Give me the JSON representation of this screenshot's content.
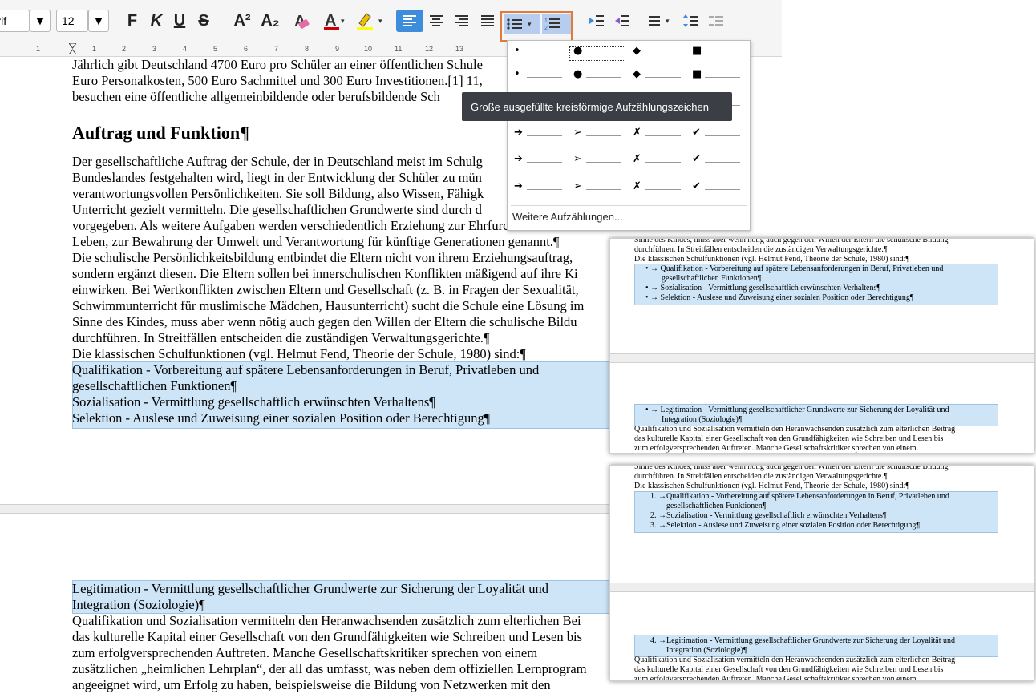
{
  "toolbar": {
    "font_name": "Liberation Serif",
    "font_size": "12",
    "bold": "F",
    "italic": "K",
    "underline": "U",
    "strike": "S",
    "superscript": "A²",
    "subscript": "A₂",
    "accent_color": "#3e8ddd",
    "highlight_border": "#e07b39"
  },
  "ruler": [
    "1",
    "1",
    "2",
    "3",
    "4",
    "5",
    "6",
    "7",
    "8",
    "9",
    "10",
    "11",
    "12",
    "13"
  ],
  "document": {
    "lines_top": [
      "Jährlich gibt Deutschland 4700 Euro pro Schüler an einer öffentlichen Schule",
      "Euro Personalkosten, 500 Euro Sachmittel und 300 Euro Investitionen.[1] 11,",
      "besuchen eine öffentliche allgemeinbildende oder berufsbildende Sch"
    ],
    "heading": "Auftrag und Funktion¶",
    "body_lines": [
      "Der gesellschaftliche Auftrag der Schule, der in Deutschland meist im Schulg",
      "Bundeslandes festgehalten wird, liegt in der Entwicklung der Schüler zu mün",
      "verantwortungsvollen Persönlichkeiten. Sie soll Bildung, also Wissen, Fähigk",
      "Unterricht gezielt vermitteln. Die gesellschaftlichen Grundwerte sind durch d",
      "vorgegeben. Als weitere Aufgaben werden verschiedentlich Erziehung zur Ehrfurcht vor dem",
      "Leben, zur Bewahrung der Umwelt und Verantwortung für künftige Generationen genannt.¶",
      "Die schulische Persönlichkeitsbildung entbindet die Eltern nicht von ihrem Erziehungsauftrag,",
      "sondern ergänzt diesen. Die Eltern sollen bei innerschulischen Konflikten mäßigend auf ihre Ki",
      "einwirken. Bei Wertkonflikten zwischen Eltern und Gesellschaft (z. B. in Fragen der Sexualität,",
      "Schwimmunterricht für muslimische Mädchen, Hausunterricht) sucht die Schule eine Lösung im",
      "Sinne des Kindes, muss aber wenn nötig auch gegen den Willen der Eltern die schulische Bildu",
      "durchführen. In Streitfällen entscheiden die zuständigen Verwaltungsgerichte.¶",
      "Die klassischen Schulfunktionen (vgl. Helmut Fend, Theorie der Schule, 1980) sind:¶"
    ],
    "selected_lines": [
      "Qualifikation - Vorbereitung auf spätere Lebensanforderungen in Beruf, Privatleben und",
      "gesellschaftlichen Funktionen¶",
      "Sozialisation - Vermittlung gesellschaftlich erwünschten Verhaltens¶",
      "Selektion - Auslese und Zuweisung einer sozialen Position oder Berechtigung¶"
    ],
    "page2_selected": [
      "Legitimation - Vermittlung gesellschaftlicher Grundwerte zur Sicherung der Loyalität und",
      "Integration (Soziologie)¶"
    ],
    "page2_lines": [
      "Qualifikation und Sozialisation vermitteln den Heranwachsenden zusätzlich zum elterlichen Bei",
      "das kulturelle Kapital einer Gesellschaft von den Grundfähigkeiten wie Schreiben und Lesen bis",
      "zum erfolgversprechenden Auftreten. Manche Gesellschaftskritiker sprechen von einem",
      "zusätzlichen „heimlichen Lehrplan“, der all das umfasst, was neben dem offiziellen Lernprogram",
      "angeeignet wird, um Erfolg zu haben, beispielsweise die Bildung von Netzwerken mit den"
    ]
  },
  "popup": {
    "more_label": "Weitere Aufzählungen...",
    "rows": [
      [
        "•",
        "●",
        "◆",
        "■"
      ],
      [
        "•",
        "●",
        "◆",
        "■"
      ],
      [
        "•",
        "●",
        "◆",
        "■"
      ],
      [
        "➔",
        "➢",
        "✗",
        "✔"
      ],
      [
        "➔",
        "➢",
        "✗",
        "✔"
      ],
      [
        "➔",
        "➢",
        "✗",
        "✔"
      ]
    ]
  },
  "tooltip": "Große ausgefüllte kreisförmige Aufzählungszeichen",
  "preview1": {
    "top_lines": [
      "Sinne des Kindes, muss aber wenn nötig auch gegen den Willen der Eltern die schulische Bildung",
      "durchführen. In Streitfällen entscheiden die zuständigen Verwaltungsgerichte.¶",
      "Die klassischen Schulfunktionen (vgl. Helmut Fend, Theorie der Schule, 1980) sind:¶"
    ],
    "items": [
      "• → Qualifikation - Vorbereitung auf spätere Lebensanforderungen in Beruf, Privatleben und",
      "gesellschaftlichen Funktionen¶",
      "• → Sozialisation - Vermittlung gesellschaftlich erwünschten Verhaltens¶",
      "• → Selektion - Auslese und Zuweisung einer sozialen Position oder Berechtigung¶"
    ],
    "page2_items": [
      "• → Legitimation - Vermittlung gesellschaftlicher Grundwerte zur Sicherung der Loyalität und",
      "Integration (Soziologie)¶"
    ],
    "page2_lines": [
      "Qualifikation und Sozialisation vermitteln den Heranwachsenden zusätzlich zum elterlichen Beitrag",
      "das kulturelle Kapital einer Gesellschaft von den Grundfähigkeiten wie Schreiben und Lesen bis",
      "zum erfolgversprechenden Auftreten. Manche Gesellschaftskritiker sprechen von einem"
    ]
  },
  "preview2": {
    "top_lines": [
      "Sinne des Kindes, muss aber wenn nötig auch gegen den Willen der Eltern die schulische Bildung",
      "durchführen. In Streitfällen entscheiden die zuständigen Verwaltungsgerichte.¶",
      "Die klassischen Schulfunktionen (vgl. Helmut Fend, Theorie der Schule, 1980) sind:¶"
    ],
    "items": [
      "1. →Qualifikation - Vorbereitung auf spätere Lebensanforderungen in Beruf, Privatleben und",
      "gesellschaftlichen Funktionen¶",
      "2. →Sozialisation - Vermittlung gesellschaftlich erwünschten Verhaltens¶",
      "3. →Selektion - Auslese und Zuweisung einer sozialen Position oder Berechtigung¶"
    ],
    "page2_items": [
      "4. →Legitimation - Vermittlung gesellschaftlicher Grundwerte zur Sicherung der Loyalität und",
      "Integration (Soziologie)¶"
    ],
    "page2_lines": [
      "Qualifikation und Sozialisation vermitteln den Heranwachsenden zusätzlich zum elterlichen Beitrag",
      "das kulturelle Kapital einer Gesellschaft von den Grundfähigkeiten wie Schreiben und Lesen bis",
      "zum erfolgversprechenden Auftreten. Manche Gesellschaftskritiker sprechen von einem"
    ]
  }
}
